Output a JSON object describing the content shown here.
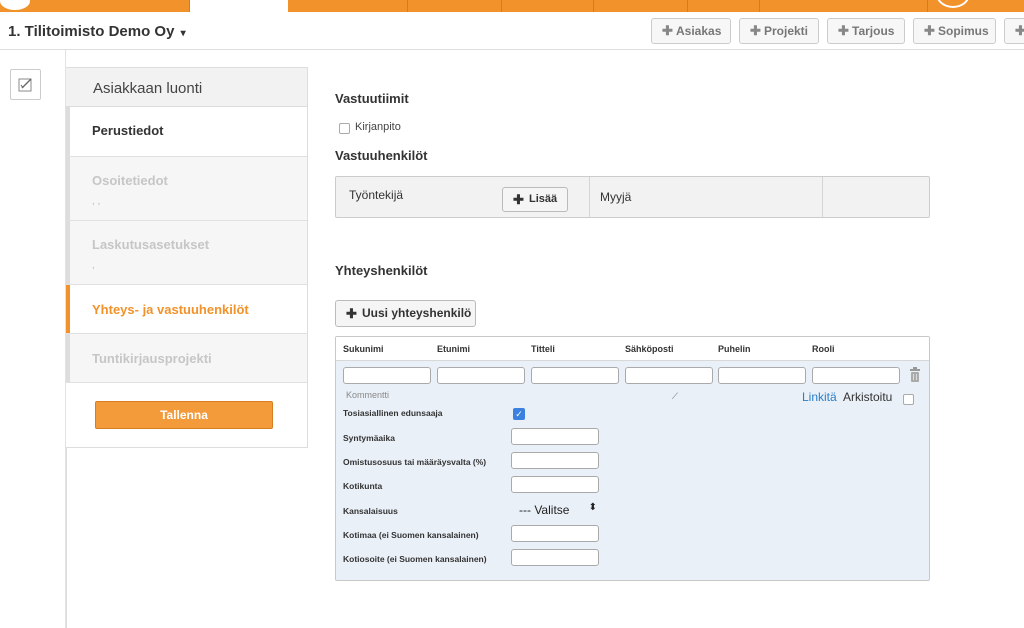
{
  "header": {
    "company": "1. Tilitoimisto Demo Oy",
    "buttons": [
      "Asiakas",
      "Projekti",
      "Tarjous",
      "Sopimus"
    ]
  },
  "nav": {
    "title": "Asiakkaan luonti",
    "items": [
      {
        "label": "Perustiedot",
        "sub": ""
      },
      {
        "label": "Osoitetiedot",
        "sub": ", ,"
      },
      {
        "label": "Laskutusasetukset",
        "sub": ","
      },
      {
        "label": "Yhteys- ja vastuuhenkilöt",
        "sub": ""
      },
      {
        "label": "Tuntikirjausprojekti",
        "sub": ""
      }
    ],
    "save": "Tallenna"
  },
  "responsibilities": {
    "title": "Vastuutiimit",
    "checkbox_label": "Kirjanpito"
  },
  "responsible_persons": {
    "title": "Vastuuhenkilöt",
    "employee_label": "Työntekijä",
    "add_button": "Lisää",
    "seller_label": "Myyjä"
  },
  "contacts": {
    "title": "Yhteyshenkilöt",
    "new_button": "Uusi yhteyshenkilö",
    "columns": [
      "Sukunimi",
      "Etunimi",
      "Titteli",
      "Sähköposti",
      "Puhelin",
      "Rooli"
    ],
    "comment_placeholder": "Kommentti",
    "link_label": "Linkitä",
    "archived_label": "Arkistoitu",
    "fields": {
      "beneficial_owner": "Tosiasiallinen edunsaaja",
      "birthdate": "Syntymäaika",
      "ownership": "Omistusosuus tai määräysvalta (%)",
      "municipality": "Kotikunta",
      "nationality": "Kansalaisuus",
      "nationality_value": "--- Valitse",
      "country": "Kotimaa (ei Suomen kansalainen)",
      "address": "Kotiosoite (ei Suomen kansalainen)"
    }
  },
  "colors": {
    "accent": "#f2922a",
    "link": "#2a7ec7",
    "checkbox": "#3b82e0"
  }
}
